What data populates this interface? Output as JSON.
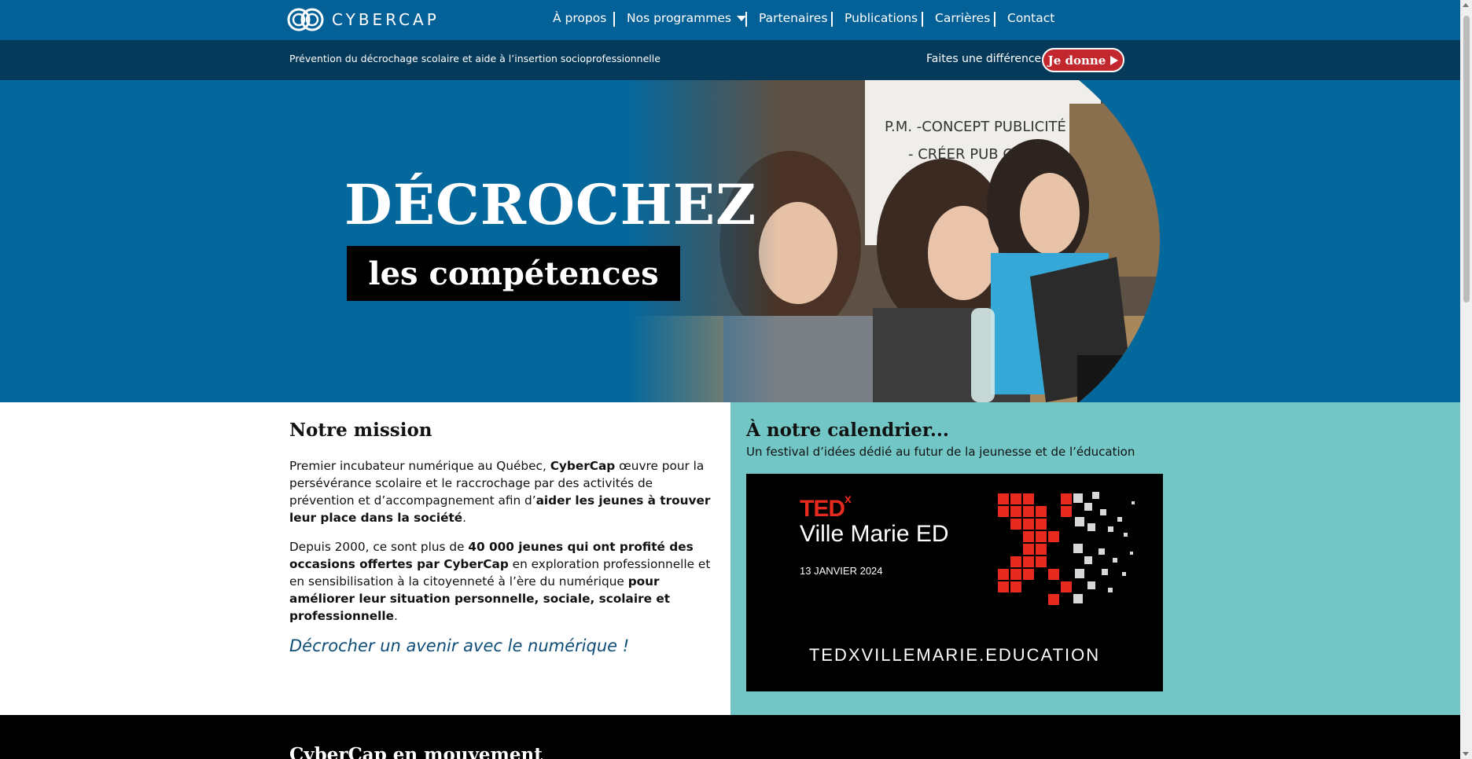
{
  "header": {
    "logo_text": "CYBERCAP",
    "nav": [
      {
        "label": "À propos"
      },
      {
        "label": "Nos programmes",
        "has_dropdown": true
      },
      {
        "label": "Partenaires"
      },
      {
        "label": "Publications"
      },
      {
        "label": "Carrières"
      },
      {
        "label": "Contact"
      }
    ]
  },
  "subbar": {
    "tagline": "Prévention du décrochage scolaire et aide à l’insertion socioprofessionnelle",
    "cta_text": "Faites une différence",
    "donate_label": "Je donne"
  },
  "hero": {
    "title": "DÉCROCHEZ",
    "subtitle": "les compétences"
  },
  "mission": {
    "heading": "Notre mission",
    "p1_a": "Premier incubateur numérique au Québec, ",
    "p1_b": "CyberCap",
    "p1_c": " œuvre pour la persévérance scolaire et le raccrochage par des activités de prévention et d’accompagnement afin d’",
    "p1_d": "aider les jeunes à trouver leur place dans la société",
    "p1_e": ".",
    "p2_a": "Depuis 2000, ce sont plus de ",
    "p2_b": "40 000 jeunes qui ont profité des occasions offertes par CyberCap",
    "p2_c": " en exploration professionnelle et en sensibilisation à la citoyenneté à l’ère du numérique ",
    "p2_d": "pour améliorer leur situation personnelle, sociale, scolaire et professionnelle",
    "p2_e": ".",
    "slogan": "Décrocher un avenir avec le numérique !"
  },
  "calendar": {
    "heading": "À notre calendrier...",
    "subtitle": "Un festival d’idées dédié au futur de la jeunesse et de l’éducation",
    "ted_word": "TED",
    "ted_x": "x",
    "ted_name": "Ville Marie ED",
    "ted_date": "13 JANVIER 2024",
    "ted_url": "TEDXVILLEMARIE.EDUCATION"
  },
  "bottom": {
    "heading": "CyberCap en mouvement"
  },
  "colors": {
    "primary": "#046197",
    "dark": "#053a5a",
    "accent": "#c1272d",
    "teal": "#72c7c6"
  }
}
